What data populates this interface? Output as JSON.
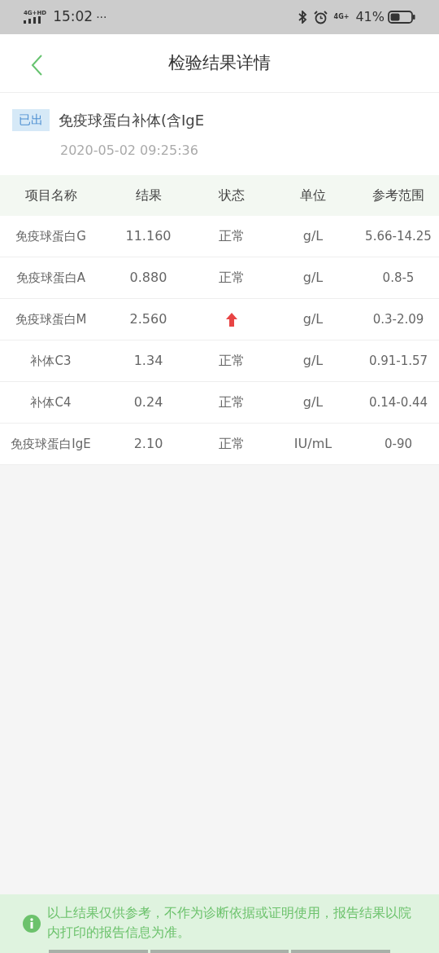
{
  "status_bar": {
    "network": "4G+HD",
    "time": "15:02",
    "more": "···",
    "data_network": "4G+",
    "battery": "41%"
  },
  "header": {
    "title": "检验结果详情"
  },
  "report": {
    "badge": "已出",
    "name": "免疫球蛋白补体(含IgE",
    "datetime": "2020-05-02 09:25:36"
  },
  "table": {
    "columns": [
      "项目名称",
      "结果",
      "状态",
      "单位",
      "参考范围"
    ],
    "rows": [
      {
        "name": "免疫球蛋白G",
        "result": "11.160",
        "status": {
          "kind": "text",
          "text": "正常"
        },
        "unit": "g/L",
        "range": "5.66-14.25"
      },
      {
        "name": "免疫球蛋白A",
        "result": "0.880",
        "status": {
          "kind": "text",
          "text": "正常"
        },
        "unit": "g/L",
        "range": "0.8-5"
      },
      {
        "name": "免疫球蛋白M",
        "result": "2.560",
        "status": {
          "kind": "high"
        },
        "unit": "g/L",
        "range": "0.3-2.09"
      },
      {
        "name": "补体C3",
        "result": "1.34",
        "status": {
          "kind": "text",
          "text": "正常"
        },
        "unit": "g/L",
        "range": "0.91-1.57"
      },
      {
        "name": "补体C4",
        "result": "0.24",
        "status": {
          "kind": "text",
          "text": "正常"
        },
        "unit": "g/L",
        "range": "0.14-0.44"
      },
      {
        "name": "免疫球蛋白IgE",
        "result": "2.10",
        "status": {
          "kind": "text",
          "text": "正常"
        },
        "unit": "IU/mL",
        "range": "0-90"
      }
    ]
  },
  "notice": {
    "text": "以上结果仅供参考，不作为诊断依据或证明使用，报告结果以院内打印的报告信息为准。"
  }
}
